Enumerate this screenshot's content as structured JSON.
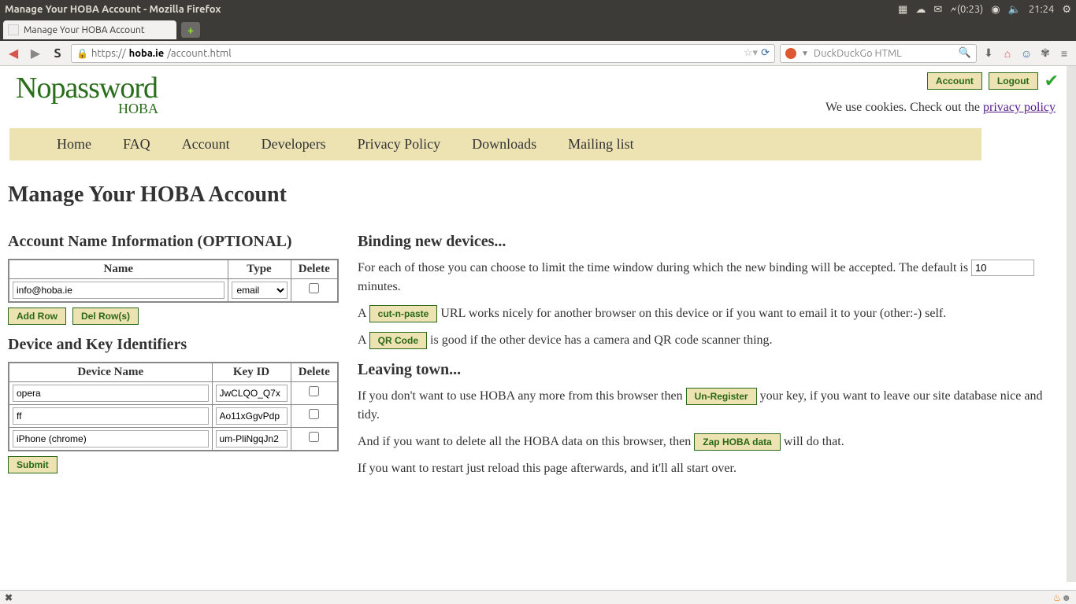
{
  "os": {
    "window_title": "Manage Your HOBA Account - Mozilla Firefox",
    "battery": "(0:23)",
    "clock": "21:24"
  },
  "browser": {
    "tab_title": "Manage Your HOBA Account",
    "url_proto": "https://",
    "url_host": "hoba.ie",
    "url_path": "/account.html",
    "search_placeholder": "DuckDuckGo HTML"
  },
  "header": {
    "account_btn": "Account",
    "logout_btn": "Logout",
    "cookies_text": "We use cookies. Check out the ",
    "privacy_link": "privacy policy",
    "logo_main": "Nopassword",
    "logo_sub": "HOBA"
  },
  "nav": {
    "home": "Home",
    "faq": "FAQ",
    "account": "Account",
    "developers": "Developers",
    "privacy": "Privacy Policy",
    "downloads": "Downloads",
    "mailing": "Mailing list"
  },
  "page": {
    "h1": "Manage Your HOBA Account",
    "acct_heading": "Account Name Information (OPTIONAL)",
    "th_name": "Name",
    "th_type": "Type",
    "th_delete": "Delete",
    "row_name": "info@hoba.ie",
    "row_type": "email",
    "add_row": "Add Row",
    "del_rows": "Del Row(s)",
    "dev_heading": "Device and Key Identifiers",
    "th_devname": "Device Name",
    "th_keyid": "Key ID",
    "devices": [
      {
        "name": "opera",
        "key": "JwCLQO_Q7x"
      },
      {
        "name": "ff",
        "key": "Ao11xGgvPdp"
      },
      {
        "name": "iPhone (chrome)",
        "key": "um-PliNgqJn2"
      }
    ],
    "submit": "Submit",
    "binding_h": "Binding new devices...",
    "binding_p1a": "For each of those you can choose to limit the time window during which the new binding will be accepted. The default is ",
    "binding_minutes": "10",
    "binding_p1b": " minutes.",
    "binding_p2a": "A ",
    "cut_paste": "cut-n-paste",
    "binding_p2b": " URL works nicely for another browser on this device or if you want to email it to your (other:-) self.",
    "binding_p3a": "A ",
    "qr_code": "QR Code",
    "binding_p3b": " is good if the other device has a camera and QR code scanner thing.",
    "leaving_h": "Leaving town...",
    "leaving_p1a": "If you don't want to use HOBA any more from this browser then ",
    "unregister": "Un-Register",
    "leaving_p1b": " your key, if you want to leave our site database nice and tidy.",
    "leaving_p2a": "And if you want to delete all the HOBA data on this browser, then ",
    "zap": "Zap HOBA data",
    "leaving_p2b": " will do that.",
    "leaving_p3": "If you want to restart just reload this page afterwards, and it'll all start over."
  }
}
